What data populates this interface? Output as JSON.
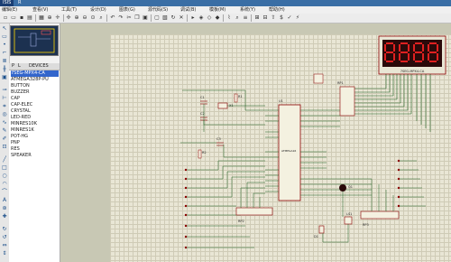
{
  "window": {
    "title": "ISIS",
    "title_extra": "R"
  },
  "menu": [
    {
      "label": "编辑(E)"
    },
    {
      "label": "查看(V)"
    },
    {
      "label": "工具(T)"
    },
    {
      "label": "设计(D)"
    },
    {
      "label": "图表(G)"
    },
    {
      "label": "源代码(S)"
    },
    {
      "label": "调试(B)"
    },
    {
      "label": "模板(M)"
    },
    {
      "label": "系统(Y)"
    },
    {
      "label": "帮助(H)"
    }
  ],
  "panel": {
    "p_label": "P",
    "l_label": "L",
    "devices_label": "DEVICES",
    "devices": [
      {
        "name": "7SEG-MPX4-CA",
        "selected": true
      },
      {
        "name": "ATMEGA328P-PU"
      },
      {
        "name": "BUTTON"
      },
      {
        "name": "BUZZER"
      },
      {
        "name": "CAP"
      },
      {
        "name": "CAP-ELEC"
      },
      {
        "name": "CRYSTAL"
      },
      {
        "name": "LED-RED"
      },
      {
        "name": "MINRES10K"
      },
      {
        "name": "MINRES1K"
      },
      {
        "name": "POT-HG"
      },
      {
        "name": "PNP"
      },
      {
        "name": "RES"
      },
      {
        "name": "SPEAKER"
      }
    ]
  },
  "schematic": {
    "display_label": "7SEG-MPX4-CA",
    "mcu_label": "U1",
    "mcu_part": "ATMEGA16",
    "rp1_label": "RP1",
    "rp2_label": "RP2",
    "rp3_label": "RP3",
    "crystal_label": "X1",
    "c1_label": "C1",
    "c2_label": "C2",
    "c3_label": "C3",
    "r1_label": "R1",
    "r2_label": "R2",
    "q1_label": "Q1",
    "ls1_label": "LS1",
    "d1_label": "D1"
  },
  "colors": {
    "sheet": "#e9e6d5",
    "wire": "#1b5e20",
    "component": "#8b0000",
    "display_bg": "#2a0a0a",
    "segment": "#e02020"
  }
}
